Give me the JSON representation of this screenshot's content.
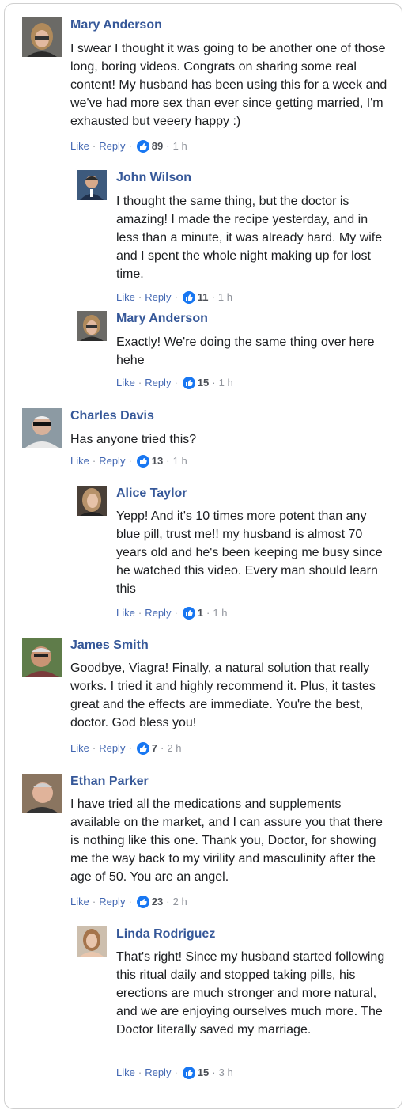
{
  "comments": [
    {
      "name": "Mary Anderson",
      "text": "I swear I thought it was going to be another one of those long, boring videos. Congrats on sharing some real content! My husband has been using this for a week and we've had more sex than ever since getting married, I'm exhausted but veeery happy :)",
      "like": "Like",
      "reply": "Reply",
      "count": "89",
      "time": "1 h",
      "avatar": "avatar-mary"
    },
    {
      "name": "John Wilson",
      "text": "I thought the same thing, but the doctor is amazing! I made the recipe yesterday, and in less than a minute, it was already hard. My wife and I spent the whole night making up for lost time.",
      "like": "Like",
      "reply": "Reply",
      "count": "11",
      "time": "1 h",
      "avatar": "avatar-john"
    },
    {
      "name": "Mary Anderson",
      "text": "Exactly! We're doing the same thing over here hehe",
      "like": "Like",
      "reply": "Reply",
      "count": "15",
      "time": "1 h",
      "avatar": "avatar-mary"
    },
    {
      "name": "Charles Davis",
      "text": "Has anyone tried this?",
      "like": "Like",
      "reply": "Reply",
      "count": "13",
      "time": "1 h",
      "avatar": "avatar-charles"
    },
    {
      "name": "Alice Taylor",
      "text": "Yepp! And it's 10 times more potent than any blue pill, trust me!! my husband is almost 70 years old and he's been keeping me busy since he watched this video. Every man should learn this",
      "like": "Like",
      "reply": "Reply",
      "count": "1",
      "time": "1 h",
      "avatar": "avatar-alice"
    },
    {
      "name": "James Smith",
      "text": "Goodbye, Viagra! Finally, a natural solution that really works. I tried it and highly recommend it. Plus, it tastes great and the effects are immediate. You're the best, doctor. God bless you!",
      "like": "Like",
      "reply": "Reply",
      "count": "7",
      "time": "2 h",
      "avatar": "avatar-james"
    },
    {
      "name": "Ethan Parker",
      "text": "I have tried all the medications and supplements available on the market, and I can assure you that there is nothing like this one. Thank you, Doctor, for showing me the way back to my virility and masculinity after the age of 50. You are an angel.",
      "like": "Like",
      "reply": "Reply",
      "count": "23",
      "time": "2 h",
      "avatar": "avatar-ethan"
    },
    {
      "name": "Linda Rodriguez",
      "text": "That's right! Since my husband started following this ritual daily and stopped taking pills, his erections are much stronger and more natural, and we are enjoying ourselves much more. The Doctor literally saved my marriage.",
      "like": "Like",
      "reply": "Reply",
      "count": "15",
      "time": "3 h",
      "avatar": "avatar-linda"
    }
  ],
  "separator": "·",
  "colors": {
    "name": "#365899",
    "link": "#4267b2",
    "meta": "#90949c",
    "like_icon": "#1877f2",
    "border": "#cfcfcf"
  }
}
